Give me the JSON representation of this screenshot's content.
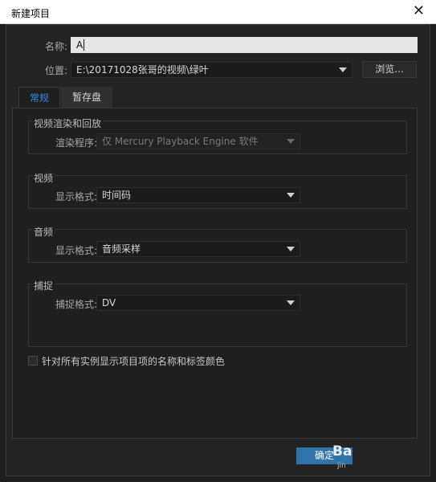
{
  "window": {
    "title": "新建项目",
    "close_glyph": "✕"
  },
  "name": {
    "label": "名称:",
    "value": "A"
  },
  "location": {
    "label": "位置:",
    "value": "E:\\20171028张哥的视频\\绿叶",
    "browse_label": "浏览..."
  },
  "tabs": [
    {
      "label": "常规",
      "active": true
    },
    {
      "label": "暂存盘",
      "active": false
    }
  ],
  "groups": {
    "video_render": {
      "title": "视频渲染和回放",
      "renderer_label": "渲染程序:",
      "renderer_value": "仅 Mercury Playback Engine 软件"
    },
    "video": {
      "title": "视频",
      "format_label": "显示格式:",
      "format_value": "时间码"
    },
    "audio": {
      "title": "音频",
      "format_label": "显示格式:",
      "format_value": "音频采样"
    },
    "capture": {
      "title": "捕捉",
      "format_label": "捕捉格式:",
      "format_value": "DV"
    }
  },
  "checkbox": {
    "label": "针对所有实例显示项目项的名称和标签颜色",
    "checked": false
  },
  "footer": {
    "ok_label": "确定",
    "watermark": "Ba",
    "watermark_sub": "jin"
  },
  "colors": {
    "accent": "#2d8ceb",
    "ok_button": "#2f74a8",
    "background": "#232323"
  }
}
